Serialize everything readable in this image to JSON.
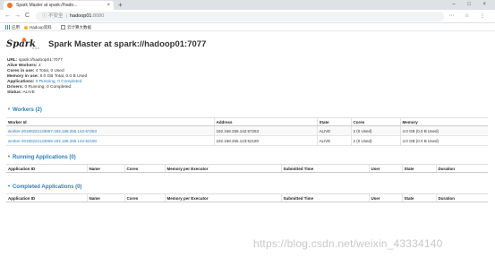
{
  "browser": {
    "tab_title": "Spark Master at spark://hado...",
    "tab_close": "×",
    "new_tab": "+",
    "window_controls": "– □ ×",
    "nav": {
      "back": "←",
      "forward": "→",
      "reload": "C"
    },
    "address": {
      "insecure_label": "不安全",
      "host": "hadoop01",
      "port": ":8080"
    },
    "toolbar_icons": "⋯ ☆ ⋮",
    "bookmarks": [
      {
        "label": "应用",
        "icon": "apps-icon"
      },
      {
        "label": "Hadoop资料",
        "icon": "bookmark-icon"
      },
      {
        "label": "云计算大数据",
        "icon": "folder-icon"
      }
    ]
  },
  "page": {
    "logo": {
      "text": "Spark",
      "star": "✱",
      "version": "2.4.0"
    },
    "title": "Spark Master at spark://hadoop01:7077",
    "summary": {
      "url_label": "URL:",
      "url_value": "spark://hadoop01:7077",
      "workers_label": "Alive Workers:",
      "workers_value": "2",
      "cores_label": "Cores in use:",
      "cores_value": "4 Total, 0 Used",
      "memory_label": "Memory in use:",
      "memory_value": "8.0 GB Total, 0.0 B Used",
      "apps_label": "Applications:",
      "apps_running": "0 Running,",
      "apps_completed": "0 Completed",
      "drivers_label": "Drivers:",
      "drivers_value": "0 Running, 0 Completed",
      "status_label": "Status:",
      "status_value": "ALIVE"
    },
    "workers": {
      "heading": "Workers (2)",
      "columns": [
        "Worker Id",
        "Address",
        "State",
        "Cores",
        "Memory"
      ],
      "rows": [
        [
          "worker-20190221133657-192.168.255.142-57263",
          "192.168.255.142:57263",
          "ALIVE",
          "2 (0 Used)",
          "4.0 GB (0.0 B Used)"
        ],
        [
          "worker-20190221133659-192.168.255.143-52180",
          "192.168.255.143:52180",
          "ALIVE",
          "2 (0 Used)",
          "4.0 GB (0.0 B Used)"
        ]
      ]
    },
    "running_apps": {
      "heading": "Running Applications (0)",
      "columns": [
        "Application ID",
        "Name",
        "Cores",
        "Memory per Executor",
        "Submitted Time",
        "User",
        "State",
        "Duration"
      ]
    },
    "completed_apps": {
      "heading": "Completed Applications (0)",
      "columns": [
        "Application ID",
        "Name",
        "Cores",
        "Memory per Executor",
        "Submitted Time",
        "User",
        "State",
        "Duration"
      ]
    },
    "watermark": "https://blog.csdn.net/weixin_43334140"
  }
}
